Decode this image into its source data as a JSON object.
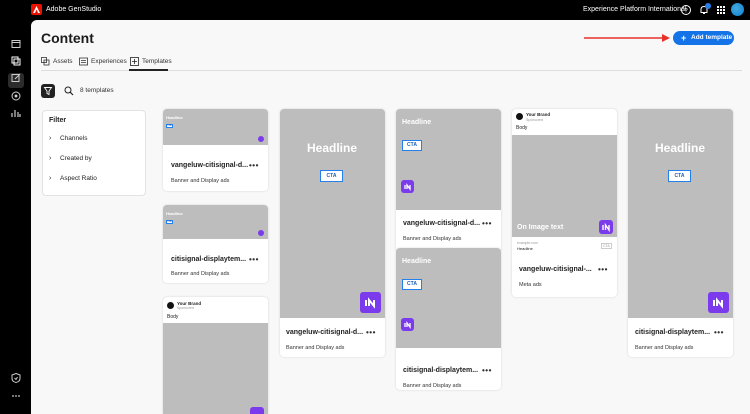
{
  "app": {
    "name": "Adobe GenStudio",
    "org": "Experience Platform International"
  },
  "icons": {
    "logo": "adobe-logo-icon",
    "help": "help-icon",
    "notifications": "bell-icon",
    "apps": "apps-grid-icon",
    "sidebar": [
      "home-icon",
      "content-icon",
      "create-icon",
      "activate-icon",
      "insights-icon",
      "brand-icon",
      "more-icon"
    ]
  },
  "page": {
    "title": "Content"
  },
  "tabs": [
    {
      "label": "Assets",
      "icon": "assets-icon"
    },
    {
      "label": "Experiences",
      "icon": "experiences-icon"
    },
    {
      "label": "Templates",
      "icon": "templates-icon",
      "active": true
    }
  ],
  "add_template": {
    "label": "Add template",
    "icon": "plus-icon"
  },
  "toolbar": {
    "count": "8 templates",
    "filter_icon": "filter-icon",
    "search_icon": "search-icon"
  },
  "filter": {
    "title": "Filter",
    "items": [
      "Channels",
      "Created by",
      "Aspect Ratio"
    ]
  },
  "cards": [
    {
      "title": "vangeluw-citisignal-d...",
      "subtitle": "Banner and Display ads",
      "preview": {
        "headline": "Headline",
        "cta": "CTA"
      }
    },
    {
      "title": "citisignal-displaytem...",
      "subtitle": "Banner and Display ads",
      "preview": {
        "headline": "Headline",
        "cta": "CTA"
      }
    },
    {
      "title": "",
      "subtitle": "",
      "preview": {
        "brand": "Your Brand",
        "sponsored": "Sponsored",
        "body": "Body"
      }
    },
    {
      "title": "vangeluw-citisignal-d...",
      "subtitle": "Banner and Display ads",
      "preview": {
        "headline": "Headline",
        "cta": "CTA"
      }
    },
    {
      "title": "vangeluw-citisignal-d...",
      "subtitle": "Banner and Display ads",
      "preview": {
        "headline": "Headline",
        "cta": "CTA"
      }
    },
    {
      "title": "citisignal-displaytem...",
      "subtitle": "Banner and Display ads",
      "preview": {
        "headline": "Headline",
        "cta": "CTA"
      }
    },
    {
      "title": "vangeluw-citisignal-...",
      "subtitle": "Meta ads",
      "preview": {
        "brand": "Your Brand",
        "sponsored": "Sponsored",
        "body": "Body",
        "image_text": "On Image text",
        "domain": "example.com",
        "headline": "Headline",
        "cta": "CTA"
      }
    },
    {
      "title": "citisignal-displaytem...",
      "subtitle": "Banner and Display ads",
      "preview": {
        "headline": "Headline",
        "cta": "CTA"
      }
    }
  ],
  "more_label": "•••"
}
